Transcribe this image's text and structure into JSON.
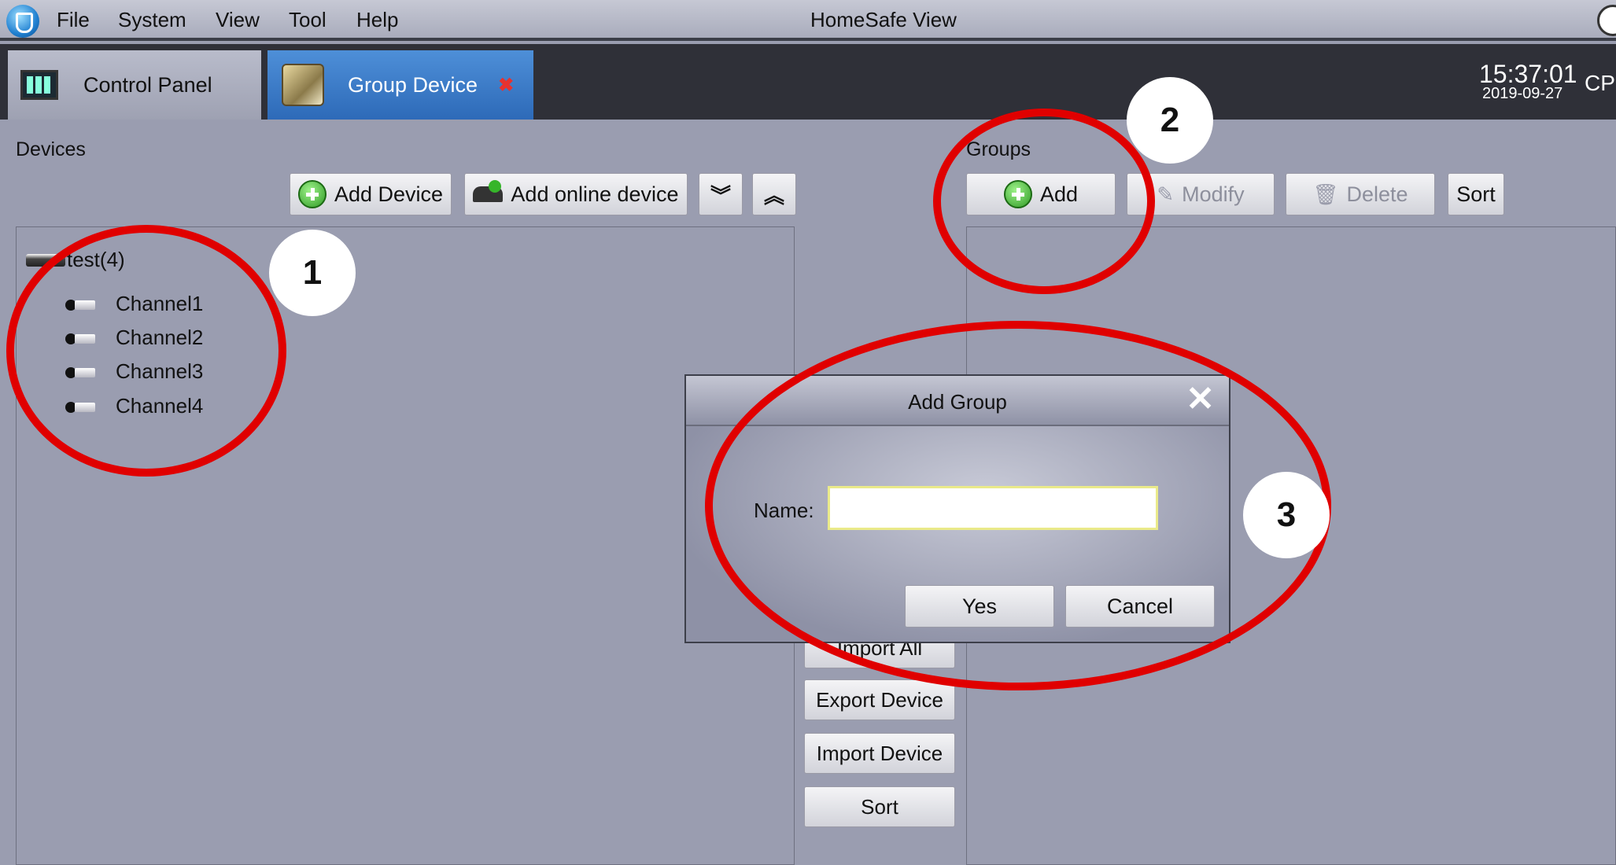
{
  "window": {
    "title": "HomeSafe View",
    "menu": [
      "File",
      "System",
      "View",
      "Tool",
      "Help"
    ]
  },
  "tabs": [
    {
      "label": "Control Panel",
      "icon": "monitor-icon"
    },
    {
      "label": "Group Device",
      "icon": "group-device-icon",
      "active": true
    }
  ],
  "clock": {
    "time": "15:37:01",
    "date": "2019-09-27",
    "cpu_label": "CP"
  },
  "devices": {
    "label": "Devices",
    "buttons": {
      "add_device": "Add Device",
      "add_online": "Add online device",
      "expand": "»",
      "collapse": "«"
    },
    "tree": {
      "root": "test(4)",
      "channels": [
        "Channel1",
        "Channel2",
        "Channel3",
        "Channel4"
      ]
    }
  },
  "middle": {
    "buttons": [
      "Import All",
      "Export Device",
      "Import Device",
      "Sort"
    ]
  },
  "groups": {
    "label": "Groups",
    "buttons": {
      "add": "Add",
      "modify": "Modify",
      "delete": "Delete",
      "sort": "Sort"
    }
  },
  "dialog": {
    "title": "Add Group",
    "name_label": "Name:",
    "name_value": "",
    "yes": "Yes",
    "cancel": "Cancel"
  },
  "annotations": {
    "badges": [
      "1",
      "2",
      "3"
    ],
    "ring_color": "#e00000"
  }
}
